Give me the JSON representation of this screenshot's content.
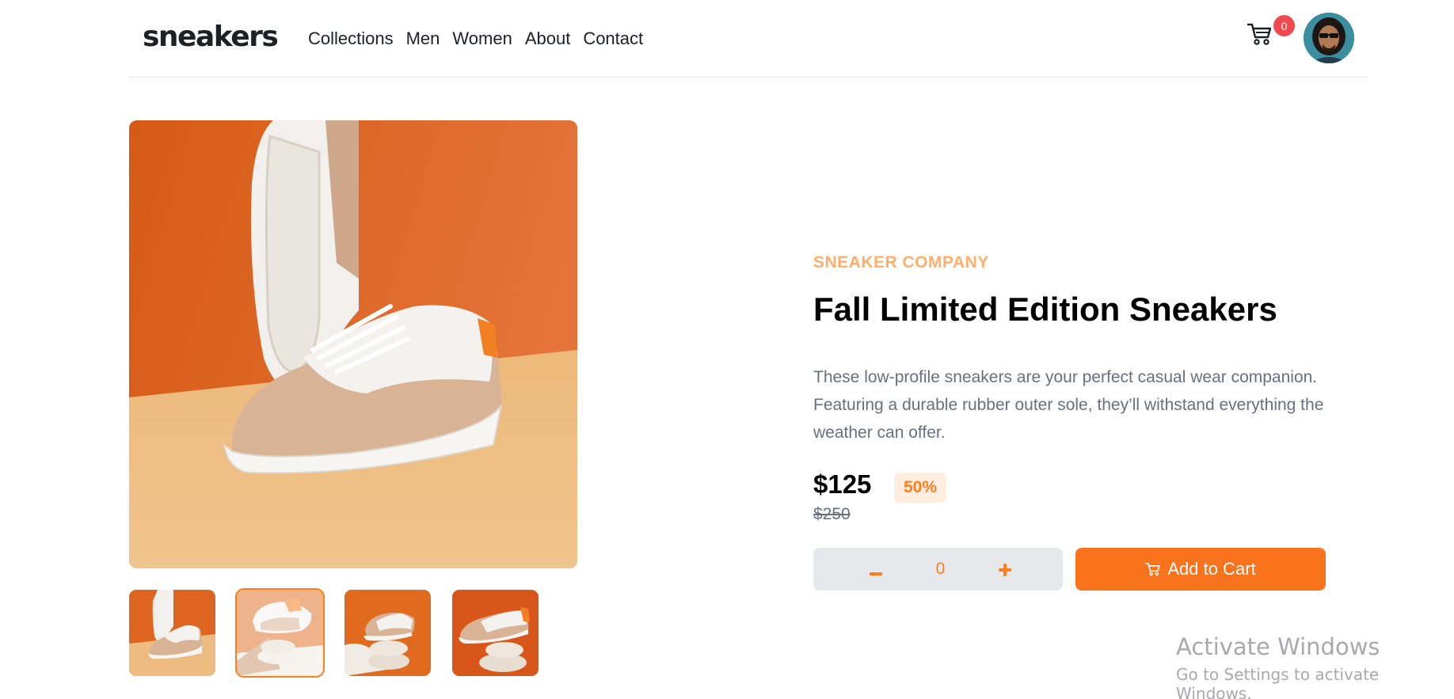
{
  "header": {
    "logo": "sneakers",
    "nav": [
      "Collections",
      "Men",
      "Women",
      "About",
      "Contact"
    ],
    "cart_count": "0",
    "cart_icon": "cart-icon",
    "avatar_icon": "user-avatar"
  },
  "gallery": {
    "selected_index": 1,
    "thumbnail_count": 4
  },
  "product": {
    "company": "SNEAKER COMPANY",
    "title": "Fall Limited Edition Sneakers",
    "description": "These low-profile sneakers are your perfect casual wear companion. Featuring a durable rubber outer sole, they’ll withstand everything the weather can offer.",
    "price": "$125",
    "discount": "50%",
    "original_price": "$250",
    "quantity": "0",
    "minus_label": "−",
    "plus_label": "+",
    "add_to_cart_label": "Add to Cart"
  },
  "watermark": {
    "title": "Activate Windows",
    "subtitle": "Go to Settings to activate Windows."
  },
  "colors": {
    "accent": "#ff7e1b",
    "accent_light": "#ffede0",
    "badge": "#f0494f",
    "company_text": "#ffae6b",
    "muted_text": "#68707d"
  }
}
